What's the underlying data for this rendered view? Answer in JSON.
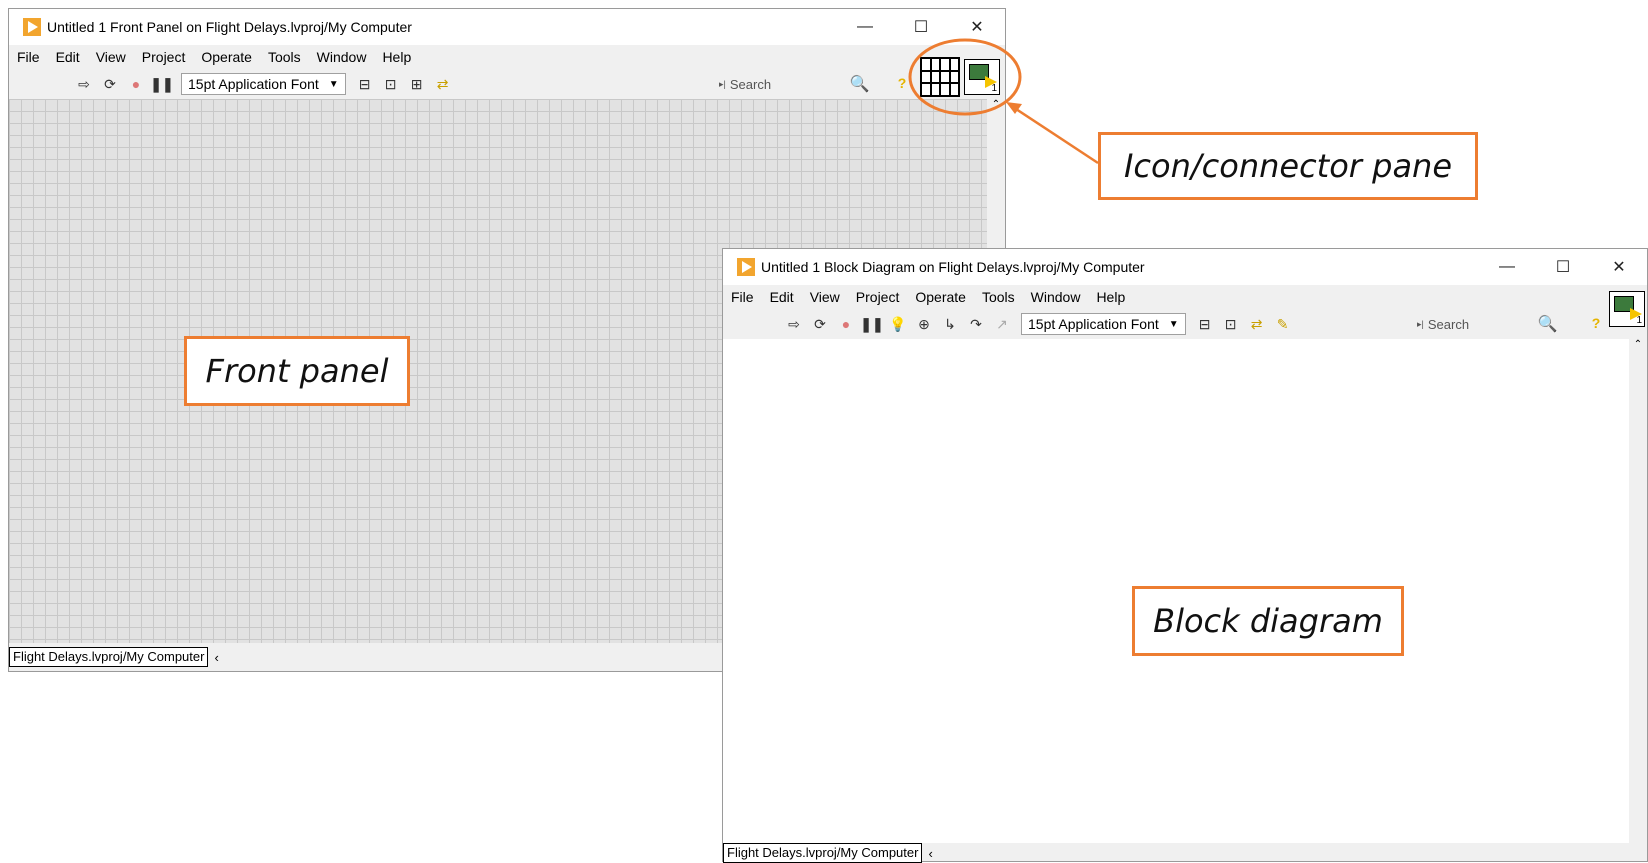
{
  "front_panel": {
    "title": "Untitled 1 Front Panel on Flight Delays.lvproj/My Computer",
    "menu": [
      "File",
      "Edit",
      "View",
      "Project",
      "Operate",
      "Tools",
      "Window",
      "Help"
    ],
    "font_select": "15pt Application Font",
    "search_placeholder": "Search",
    "status": "Flight Delays.lvproj/My Computer",
    "vi_icon_number": "1"
  },
  "block_diagram": {
    "title": "Untitled 1 Block Diagram on Flight Delays.lvproj/My Computer",
    "menu": [
      "File",
      "Edit",
      "View",
      "Project",
      "Operate",
      "Tools",
      "Window",
      "Help"
    ],
    "font_select": "15pt Application Font",
    "search_placeholder": "Search",
    "status": "Flight Delays.lvproj/My Computer",
    "vi_icon_number": "1"
  },
  "callouts": {
    "icon_connector": "Icon/connector pane",
    "front_panel": "Front panel",
    "block_diagram": "Block diagram"
  },
  "window_controls": {
    "minimize": "—",
    "maximize": "☐",
    "close": "✕"
  },
  "colors": {
    "accent": "#ed7d31",
    "grid_bg": "#e2e2e2"
  }
}
